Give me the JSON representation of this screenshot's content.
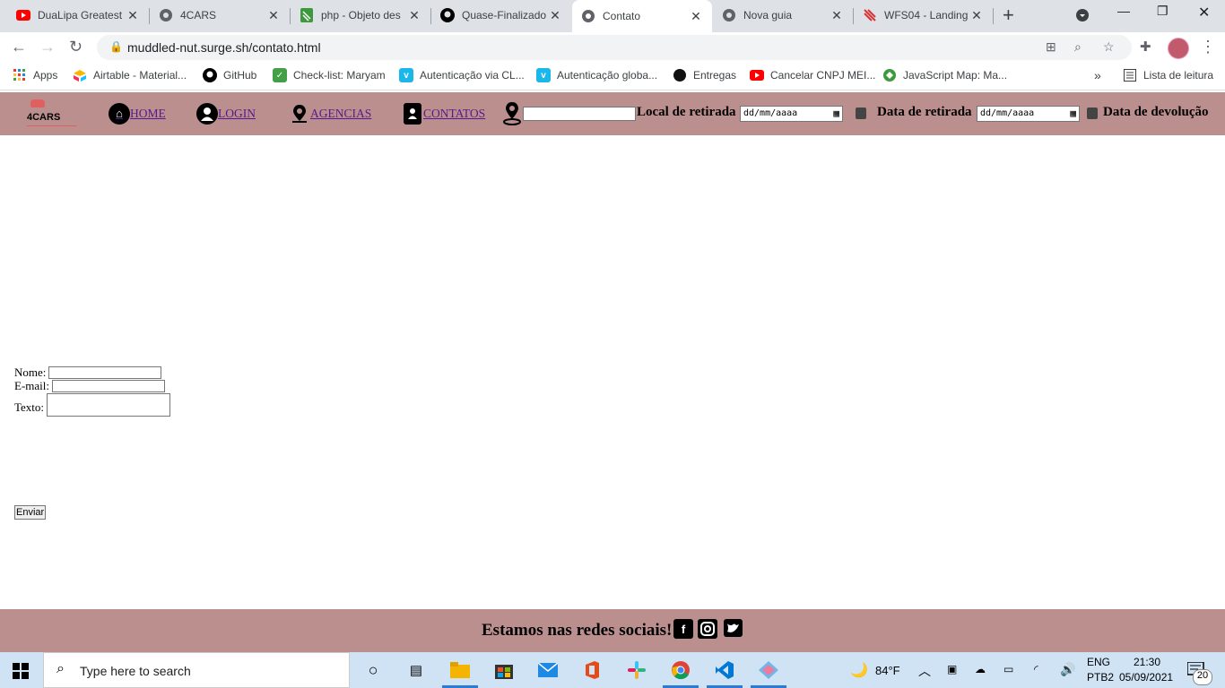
{
  "browser": {
    "tabs": [
      {
        "title": "DuaLipa Greatest",
        "icon": "youtube-icon",
        "color": "#ff0000"
      },
      {
        "title": "4CARS",
        "icon": "globe-icon",
        "color": "#5f6368"
      },
      {
        "title": "php - Objeto des",
        "icon": "stack-icon",
        "color": "#3c9a3c"
      },
      {
        "title": "Quase-Finalizado",
        "icon": "github-icon",
        "color": "#000000"
      },
      {
        "title": "Contato",
        "icon": "globe-icon",
        "color": "#5f6368"
      },
      {
        "title": "Nova guia",
        "icon": "chrome-icon",
        "color": "#5f6368"
      },
      {
        "title": "WFS04 - Landing",
        "icon": "brand-icon",
        "color": "#d33"
      }
    ],
    "url": "muddled-nut.surge.sh/contato.html",
    "bookmarks": [
      {
        "label": "Apps",
        "icon": "apps-grid-icon",
        "color": "#e53935"
      },
      {
        "label": "Airtable - Material...",
        "icon": "airtable-icon",
        "color": "#fcb400"
      },
      {
        "label": "GitHub",
        "icon": "github-icon",
        "color": "#000000"
      },
      {
        "label": "Check-list: Maryam",
        "icon": "checkbox-icon",
        "color": "#2e7d32"
      },
      {
        "label": "Autenticação via CL...",
        "icon": "vimeo-icon",
        "color": "#1ab7ea"
      },
      {
        "label": "Autenticação globa...",
        "icon": "vimeo-icon",
        "color": "#1ab7ea"
      },
      {
        "label": "Entregas",
        "icon": "circle-icon",
        "color": "#000000"
      },
      {
        "label": "Cancelar CNPJ MEI...",
        "icon": "youtube-icon",
        "color": "#ff0000"
      },
      {
        "label": "JavaScript Map: Ma...",
        "icon": "globe-leaf-icon",
        "color": "#3c9a3c"
      }
    ],
    "reading_list": "Lista de leitura"
  },
  "site": {
    "logo": "4CARS",
    "nav": {
      "home": "HOME",
      "login": "LOGIN",
      "agencias": "AGENCIAS",
      "contatos": "CONTATOS"
    },
    "local_retirada": "Local de retirada",
    "date_placeholder": "dd/mm/aaaa",
    "data_retirada": "Data de retirada",
    "data_devolucao": "Data de devolução",
    "form": {
      "nome_label": "Nome:",
      "email_label": "E-mail:",
      "texto_label": "Texto:",
      "submit": "Enviar"
    },
    "footer": {
      "text": "Estamos nas redes sociais!"
    },
    "colors": {
      "bar": "#bc8f8f",
      "link": "#551a8b"
    }
  },
  "taskbar": {
    "search_placeholder": "Type here to search",
    "weather": "84°F",
    "lang": "ENG",
    "layout": "PTB2",
    "time": "21:30",
    "date": "05/09/2021",
    "notifications": "20"
  }
}
